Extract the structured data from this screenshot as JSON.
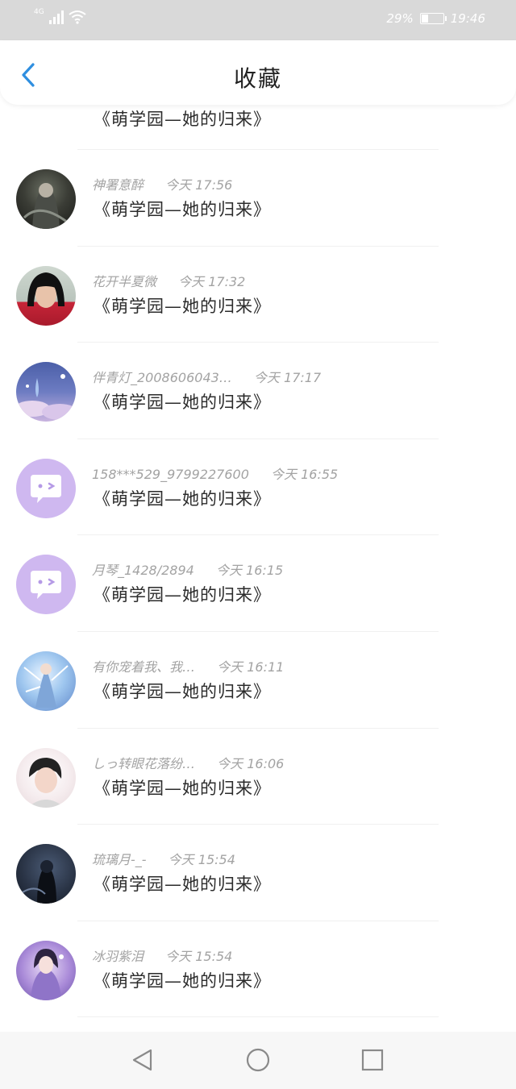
{
  "status_bar": {
    "network": "4G",
    "battery": "29%",
    "time": "19:46"
  },
  "header": {
    "title": "收藏"
  },
  "list": {
    "partial_title": "《萌学园—她的归来》",
    "items": [
      {
        "name": "神署意醉",
        "day": "今天",
        "time": "17:56",
        "title": "《萌学园—她的归来》"
      },
      {
        "name": "花开半夏微",
        "day": "今天",
        "time": "17:32",
        "title": "《萌学园—她的归来》"
      },
      {
        "name": "伴青灯_2008606043…",
        "day": "今天",
        "time": "17:17",
        "title": "《萌学园—她的归来》"
      },
      {
        "name": "158***529_9799227600",
        "day": "今天",
        "time": "16:55",
        "title": "《萌学园—她的归来》"
      },
      {
        "name": "月琴_1428/2894",
        "day": "今天",
        "time": "16:15",
        "title": "《萌学园—她的归来》"
      },
      {
        "name": "有你宠着我、我…",
        "day": "今天",
        "time": "16:11",
        "title": "《萌学园—她的归来》"
      },
      {
        "name": "しっ转眼花落纷…",
        "day": "今天",
        "time": "16:06",
        "title": "《萌学园—她的归来》"
      },
      {
        "name": "琉璃月-_-",
        "day": "今天",
        "time": "15:54",
        "title": "《萌学园—她的归来》"
      },
      {
        "name": "冰羽紫泪",
        "day": "今天",
        "time": "15:54",
        "title": "《萌学园—她的归来》"
      }
    ]
  },
  "colors": {
    "accent": "#2f8fe0",
    "status_bar_bg": "#d9d9d9",
    "meta_text": "#a3a3a3",
    "default_avatar": "#cfb8f0"
  },
  "icons": {
    "back": "chevron-left-icon",
    "nav_back": "triangle-back-icon",
    "nav_home": "circle-home-icon",
    "nav_recent": "square-recent-icon"
  }
}
